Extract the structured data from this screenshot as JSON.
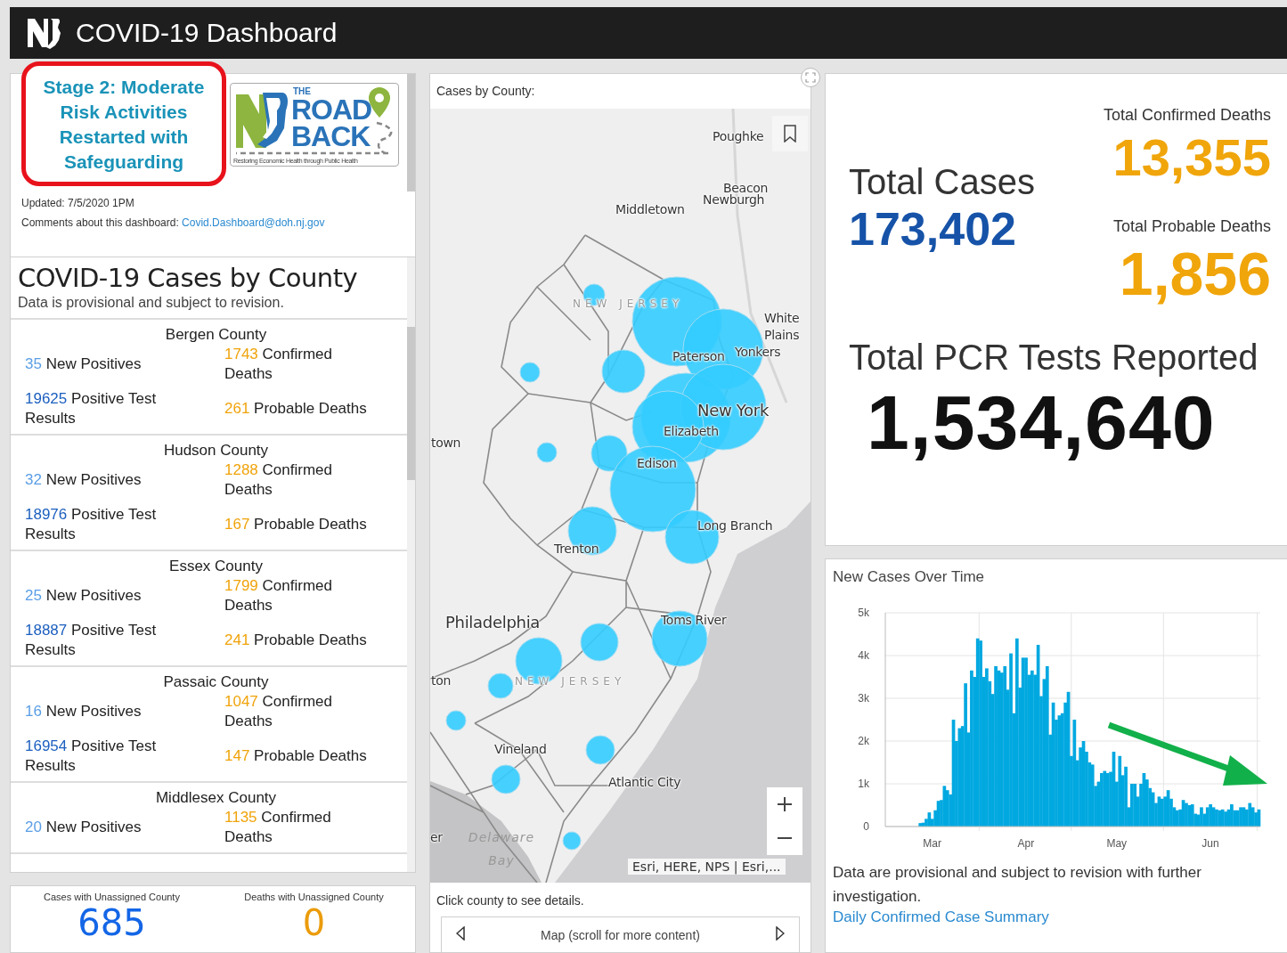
{
  "header": {
    "title": "COVID-19 Dashboard"
  },
  "info": {
    "stage": "Stage 2: Moderate Risk Activities Restarted with Safeguarding",
    "logo": {
      "the": "THE",
      "road": "ROAD",
      "back": "BACK",
      "tagline": "Restoring Economic Health through Public Health"
    },
    "updated": "Updated: 7/5/2020 1PM",
    "comments_label": "Comments about this dashboard:",
    "comments_email": "Covid.Dashboard@doh.nj.gov"
  },
  "county_list": {
    "title": "COVID-19 Cases by County",
    "subtitle": "Data is provisional and subject to revision.",
    "counties": [
      {
        "name": "Bergen County",
        "new_positives": "35",
        "new_positives_label": "New Positives",
        "confirmed_deaths": "1743",
        "confirmed_deaths_label": "Confirmed Deaths",
        "positive_tests": "19625",
        "positive_tests_label": "Positive Test Results",
        "probable_deaths": "261",
        "probable_deaths_label": "Probable Deaths"
      },
      {
        "name": "Hudson County",
        "new_positives": "32",
        "new_positives_label": "New Positives",
        "confirmed_deaths": "1288",
        "confirmed_deaths_label": "Confirmed Deaths",
        "positive_tests": "18976",
        "positive_tests_label": "Positive Test Results",
        "probable_deaths": "167",
        "probable_deaths_label": "Probable Deaths"
      },
      {
        "name": "Essex County",
        "new_positives": "25",
        "new_positives_label": "New Positives",
        "confirmed_deaths": "1799",
        "confirmed_deaths_label": "Confirmed Deaths",
        "positive_tests": "18887",
        "positive_tests_label": "Positive Test Results",
        "probable_deaths": "241",
        "probable_deaths_label": "Probable Deaths"
      },
      {
        "name": "Passaic County",
        "new_positives": "16",
        "new_positives_label": "New Positives",
        "confirmed_deaths": "1047",
        "confirmed_deaths_label": "Confirmed Deaths",
        "positive_tests": "16954",
        "positive_tests_label": "Positive Test Results",
        "probable_deaths": "147",
        "probable_deaths_label": "Probable Deaths"
      },
      {
        "name": "Middlesex County",
        "new_positives": "20",
        "new_positives_label": "New Positives",
        "confirmed_deaths": "1135",
        "confirmed_deaths_label": "Confirmed Deaths"
      }
    ]
  },
  "unassigned": [
    {
      "label": "Cases with Unassigned County",
      "value": "685",
      "kind": "cases"
    },
    {
      "label": "Deaths with Unassigned County",
      "value": "0",
      "kind": "deaths"
    }
  ],
  "map": {
    "title": "Cases by County:",
    "labels": [
      {
        "text": "Poughke",
        "kind": "city"
      },
      {
        "text": "Beacon",
        "kind": "city"
      },
      {
        "text": "Newburgh",
        "kind": "city"
      },
      {
        "text": "Middletown",
        "kind": "city"
      },
      {
        "text": "NEW JERSEY",
        "kind": "state"
      },
      {
        "text": "White Plains",
        "kind": "city"
      },
      {
        "text": "Paterson",
        "kind": "city"
      },
      {
        "text": "Yonkers",
        "kind": "city"
      },
      {
        "text": "New York",
        "kind": "major"
      },
      {
        "text": "Elizabeth",
        "kind": "city"
      },
      {
        "text": "Edison",
        "kind": "city"
      },
      {
        "text": "town",
        "kind": "city"
      },
      {
        "text": "Long Branch",
        "kind": "city"
      },
      {
        "text": "Trenton",
        "kind": "city"
      },
      {
        "text": "Philadelphia",
        "kind": "major"
      },
      {
        "text": "ton",
        "kind": "city"
      },
      {
        "text": "NEW JERSEY",
        "kind": "state"
      },
      {
        "text": "Toms River",
        "kind": "city"
      },
      {
        "text": "Vineland",
        "kind": "city"
      },
      {
        "text": "Atlantic City",
        "kind": "city"
      },
      {
        "text": "er",
        "kind": "city"
      },
      {
        "text": "Delaware Bay",
        "kind": "water"
      }
    ],
    "attribution": "Esri, HERE, NPS | Esri,...",
    "footer": "Click county to see details.",
    "nav_label": "Map (scroll for more content)"
  },
  "totals": {
    "confirmed_deaths_label": "Total Confirmed Deaths",
    "confirmed_deaths": "13,355",
    "cases_label": "Total Cases",
    "cases": "173,402",
    "probable_deaths_label": "Total Probable Deaths",
    "probable_deaths": "1,856",
    "pcr_label": "Total PCR Tests Reported",
    "pcr": "1,534,640"
  },
  "new_cases": {
    "title": "New Cases Over Time",
    "chart_data": {
      "type": "bar",
      "grid": true,
      "categories": [
        null,
        null,
        null,
        null,
        null,
        null,
        null,
        null,
        null,
        null,
        null,
        null,
        null,
        null,
        null,
        "Mar",
        null,
        null,
        null,
        null,
        null,
        null,
        null,
        null,
        null,
        null,
        null,
        null,
        null,
        null,
        null,
        null,
        null,
        null,
        null,
        null,
        null,
        null,
        null,
        null,
        null,
        null,
        null,
        null,
        null,
        null,
        "Apr",
        null,
        null,
        null,
        null,
        null,
        null,
        null,
        null,
        null,
        null,
        null,
        null,
        null,
        null,
        null,
        null,
        null,
        null,
        null,
        null,
        null,
        null,
        null,
        null,
        null,
        null,
        null,
        null,
        null,
        "May",
        null,
        null,
        null,
        null,
        null,
        null,
        null,
        null,
        null,
        null,
        null,
        null,
        null,
        null,
        null,
        null,
        null,
        null,
        null,
        null,
        null,
        null,
        null,
        null,
        null,
        null,
        null,
        null,
        null,
        null,
        "Jun",
        null,
        null,
        null,
        null,
        null,
        null,
        null,
        null,
        null,
        null,
        null,
        null,
        null,
        null,
        null,
        null
      ],
      "ylim": [
        0,
        5000
      ],
      "yticks": [
        {
          "value": 0,
          "label": "0"
        },
        {
          "value": 1000,
          "label": "1k"
        },
        {
          "value": 2000,
          "label": "2k"
        },
        {
          "value": 3000,
          "label": "3k"
        },
        {
          "value": 4000,
          "label": "4k"
        },
        {
          "value": 5000,
          "label": "5k"
        }
      ],
      "series": [
        {
          "color": "#00a8e0",
          "values": [
            0,
            0,
            0,
            0,
            0,
            0,
            0,
            0,
            null,
            null,
            null,
            80,
            90,
            180,
            330,
            180,
            380,
            600,
            620,
            950,
            850,
            750,
            2500,
            2000,
            2300,
            2350,
            3350,
            2200,
            3650,
            3500,
            4400,
            4350,
            3500,
            3700,
            3400,
            3100,
            3750,
            3650,
            3600,
            3750,
            3200,
            4050,
            2650,
            4400,
            3250,
            3950,
            3950,
            3550,
            3650,
            3550,
            4250,
            3050,
            3450,
            3750,
            2150,
            2900,
            2500,
            2600,
            2650,
            2900,
            3150,
            1650,
            2500,
            1550,
            1850,
            2000,
            1750,
            1500,
            1450,
            950,
            1050,
            1250,
            1300,
            1250,
            1280,
            1750,
            1050,
            1650,
            1200,
            1400,
            450,
            1000,
            1000,
            700,
            1000,
            1250,
            1100,
            900,
            800,
            550,
            700,
            650,
            700,
            850,
            650,
            450,
            380,
            400,
            620,
            550,
            500,
            520,
            300,
            280,
            450,
            300,
            450,
            520,
            450,
            400,
            380,
            400,
            350,
            400,
            520,
            380,
            380,
            450,
            450,
            400,
            550,
            450,
            330,
            400
          ]
        }
      ]
    },
    "note": "Data are provisional and subject to revision with further investigation.",
    "link": "Daily Confirmed Case Summary"
  }
}
